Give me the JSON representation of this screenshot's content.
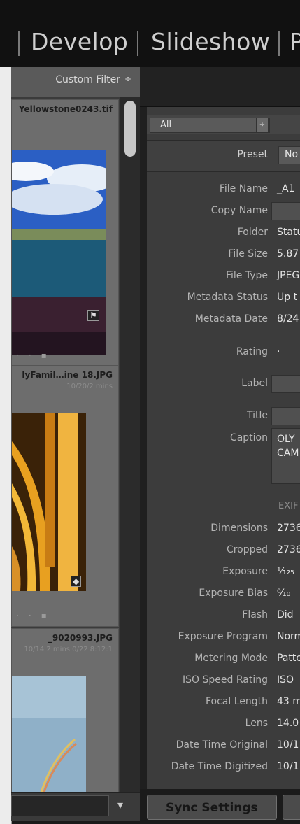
{
  "modules": [
    "Develop",
    "Slideshow",
    "P"
  ],
  "filter": {
    "label": "Custom Filter",
    "arrow": "÷"
  },
  "filmstrip": [
    {
      "name": "Yellowstone0243.tif",
      "sub": ""
    },
    {
      "name": "lyFamil…ine 18.JPG",
      "sub": "10/20/2 mins"
    },
    {
      "name": "_9020993.JPG",
      "sub": "10/14 2 mins 0/22 8:12:1"
    }
  ],
  "metadata": {
    "view": "All",
    "preset_label": "Preset",
    "preset_value": "No",
    "fields": [
      {
        "k": "File Name",
        "v": "_A1"
      },
      {
        "k": "Copy Name",
        "v": ""
      },
      {
        "k": "Folder",
        "v": "Statu"
      },
      {
        "k": "File Size",
        "v": "5.87"
      },
      {
        "k": "File Type",
        "v": "JPEG"
      },
      {
        "k": "Metadata Status",
        "v": "Up t"
      },
      {
        "k": "Metadata Date",
        "v": "8/24"
      },
      {
        "k": "Rating",
        "v": "·"
      },
      {
        "k": "Label",
        "v": ""
      },
      {
        "k": "Title",
        "v": ""
      },
      {
        "k": "Caption",
        "v": "OLY CAM"
      }
    ],
    "exif_heading": "EXIF",
    "exif": [
      {
        "k": "Dimensions",
        "v": "2736"
      },
      {
        "k": "Cropped",
        "v": "2736"
      },
      {
        "k": "Exposure",
        "v": "¹⁄₁₂₅"
      },
      {
        "k": "Exposure Bias",
        "v": "⁰⁄₁₀"
      },
      {
        "k": "Flash",
        "v": "Did"
      },
      {
        "k": "Exposure Program",
        "v": "Norm"
      },
      {
        "k": "Metering Mode",
        "v": "Patte"
      },
      {
        "k": "ISO Speed Rating",
        "v": "ISO"
      },
      {
        "k": "Focal Length",
        "v": "43 m"
      },
      {
        "k": "Lens",
        "v": "14.0"
      },
      {
        "k": "Date Time Original",
        "v": "10/1"
      },
      {
        "k": "Date Time Digitized",
        "v": "10/1"
      }
    ]
  },
  "sync_button": "Sync Settings"
}
